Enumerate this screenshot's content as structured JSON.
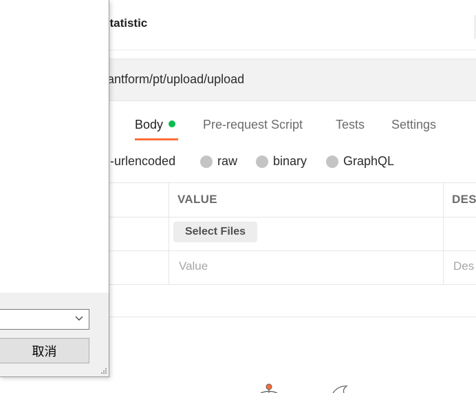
{
  "request": {
    "title": "statistic",
    "url": "antform/pt/upload/upload"
  },
  "tabs": [
    {
      "label": "Body",
      "active": true,
      "indicator_color": "#0cbb52"
    },
    {
      "label": "Pre-request Script"
    },
    {
      "label": "Tests"
    },
    {
      "label": "Settings"
    }
  ],
  "body_types": [
    {
      "label": "n-urlencoded",
      "selected": false
    },
    {
      "label": "raw",
      "selected": false
    },
    {
      "label": "binary",
      "selected": false
    },
    {
      "label": "GraphQL",
      "selected": false
    }
  ],
  "table": {
    "headers": {
      "value": "VALUE",
      "description": "DES"
    },
    "rows": [
      {
        "value_button": "Select Files"
      },
      {
        "value_placeholder": "Value",
        "description_placeholder": "Des"
      }
    ]
  },
  "dialog": {
    "file_type_value": "",
    "cancel_label": "取消"
  },
  "colors": {
    "accent": "#ff6c37",
    "active_dot": "#0cbb52"
  }
}
